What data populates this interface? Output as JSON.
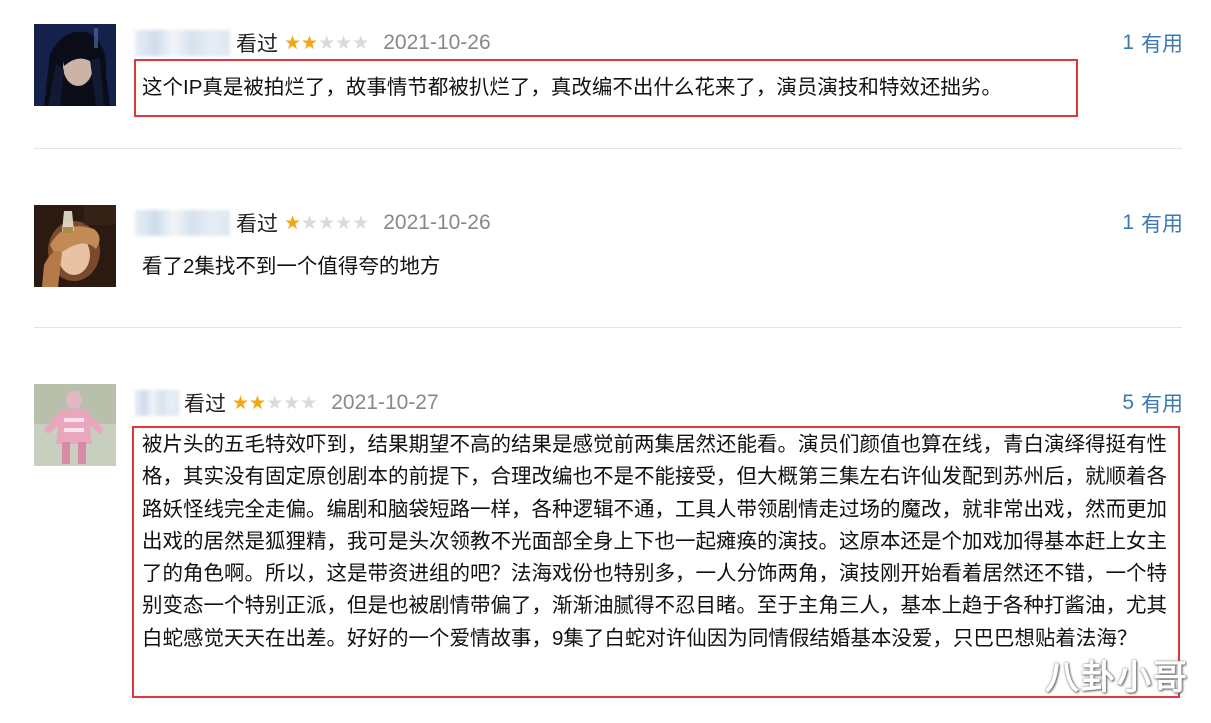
{
  "comments": [
    {
      "watched": "看过",
      "rating": 2,
      "date": "2021-10-26",
      "votes": "1",
      "useful_label": "有用",
      "text": "这个IP真是被拍烂了，故事情节都被扒烂了，真改编不出什么花来了，演员演技和特效还拙劣。"
    },
    {
      "watched": "看过",
      "rating": 1,
      "date": "2021-10-26",
      "votes": "1",
      "useful_label": "有用",
      "text": "看了2集找不到一个值得夸的地方"
    },
    {
      "watched": "看过",
      "rating": 2,
      "date": "2021-10-27",
      "votes": "5",
      "useful_label": "有用",
      "text": "被片头的五毛特效吓到，结果期望不高的结果是感觉前两集居然还能看。演员们颜值也算在线，青白演绎得挺有性格，其实没有固定原创剧本的前提下，合理改编也不是不能接受，但大概第三集左右许仙发配到苏州后，就顺着各路妖怪线完全走偏。编剧和脑袋短路一样，各种逻辑不通，工具人带领剧情走过场的魔改，就非常出戏，然而更加出戏的居然是狐狸精，我可是头次领教不光面部全身上下也一起瘫痪的演技。这原本还是个加戏加得基本赶上女主了的角色啊。所以，这是带资进组的吧？法海戏份也特别多，一人分饰两角，演技刚开始看着居然还不错，一个特别变态一个特别正派，但是也被剧情带偏了，渐渐油腻得不忍目睹。至于主角三人，基本上趋于各种打酱油，尤其白蛇感觉天天在出差。好好的一个爱情故事，9集了白蛇对许仙因为同情假结婚基本没爱，只巴巴想贴着法海？"
    }
  ],
  "watermark": "八卦小哥",
  "colors": {
    "highlight": "#e0373b",
    "link": "#3d79b4",
    "star_on": "#f3a712",
    "star_off": "#dadada"
  }
}
